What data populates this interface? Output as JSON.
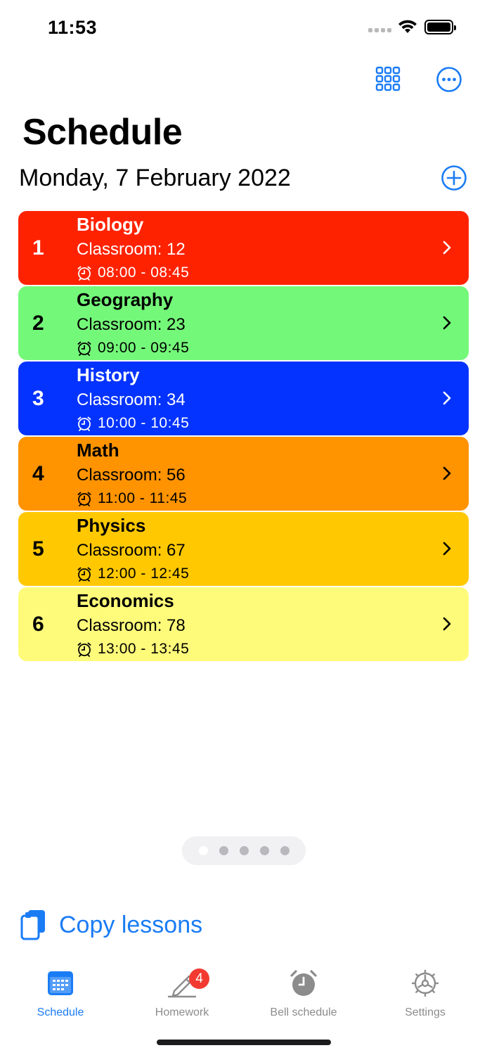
{
  "status_bar": {
    "time": "11:53"
  },
  "header": {
    "title": "Schedule",
    "date": "Monday, 7 February 2022"
  },
  "lessons": [
    {
      "number": "1",
      "subject": "Biology",
      "classroom": "Classroom: 12",
      "time": "08:00 - 08:45",
      "color": "#ff2200",
      "text_color": "#ffffff"
    },
    {
      "number": "2",
      "subject": "Geography",
      "classroom": "Classroom: 23",
      "time": "09:00 - 09:45",
      "color": "#74f879",
      "text_color": "#000000"
    },
    {
      "number": "3",
      "subject": "History",
      "classroom": "Classroom: 34",
      "time": "10:00 - 10:45",
      "color": "#0433ff",
      "text_color": "#ffffff"
    },
    {
      "number": "4",
      "subject": "Math",
      "classroom": "Classroom: 56",
      "time": "11:00 - 11:45",
      "color": "#ff9300",
      "text_color": "#000000"
    },
    {
      "number": "5",
      "subject": "Physics",
      "classroom": "Classroom: 67",
      "time": "12:00 - 12:45",
      "color": "#ffc800",
      "text_color": "#000000"
    },
    {
      "number": "6",
      "subject": "Economics",
      "classroom": "Classroom: 78",
      "time": "13:00 - 13:45",
      "color": "#fffb7a",
      "text_color": "#000000"
    }
  ],
  "pager": {
    "page_count": 5,
    "active_index": 0
  },
  "copy_lessons_label": "Copy lessons",
  "tabs": [
    {
      "label": "Schedule",
      "icon": "calendar-icon",
      "active": true
    },
    {
      "label": "Homework",
      "icon": "pencil-icon",
      "badge": "4"
    },
    {
      "label": "Bell schedule",
      "icon": "alarm-clock-icon"
    },
    {
      "label": "Settings",
      "icon": "gear-icon"
    }
  ],
  "colors": {
    "accent": "#1a7cf5",
    "inactive": "#8c8c8c"
  }
}
